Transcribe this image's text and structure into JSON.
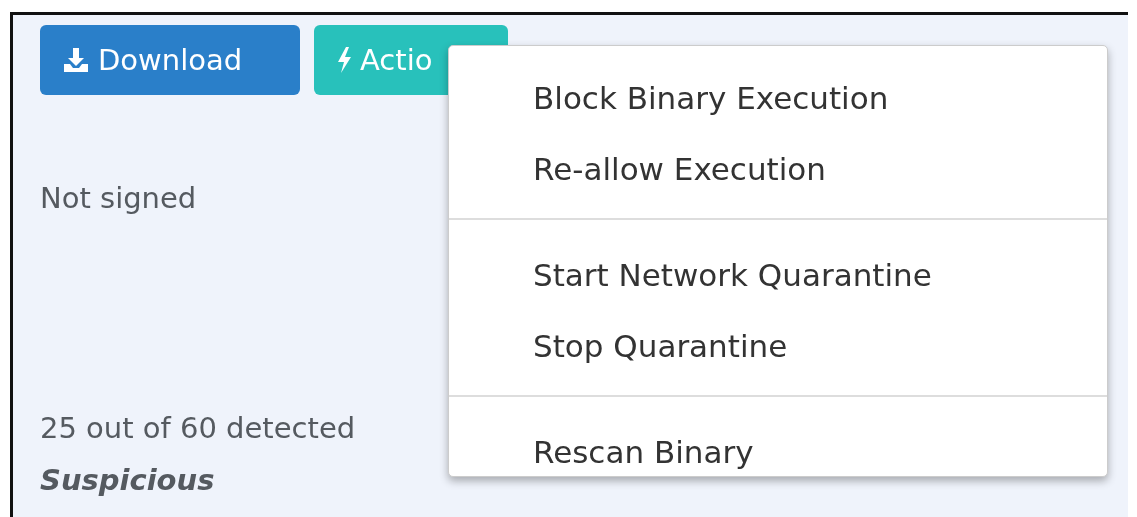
{
  "toolbar": {
    "buttons": [
      {
        "kind": "download",
        "label": "Download"
      },
      {
        "kind": "actions",
        "label": "Actio"
      }
    ]
  },
  "details": [
    {
      "kind": "plain",
      "text": "Not signed"
    },
    {
      "kind": "plain",
      "text": "25 out of 60 detected"
    },
    {
      "kind": "verdict",
      "text": "Suspicious"
    }
  ],
  "menu": {
    "groups": [
      [
        "Block Binary Execution",
        "Re-allow Execution"
      ],
      [
        "Start Network Quarantine",
        "Stop Quarantine"
      ],
      [
        "Rescan Binary"
      ]
    ]
  }
}
